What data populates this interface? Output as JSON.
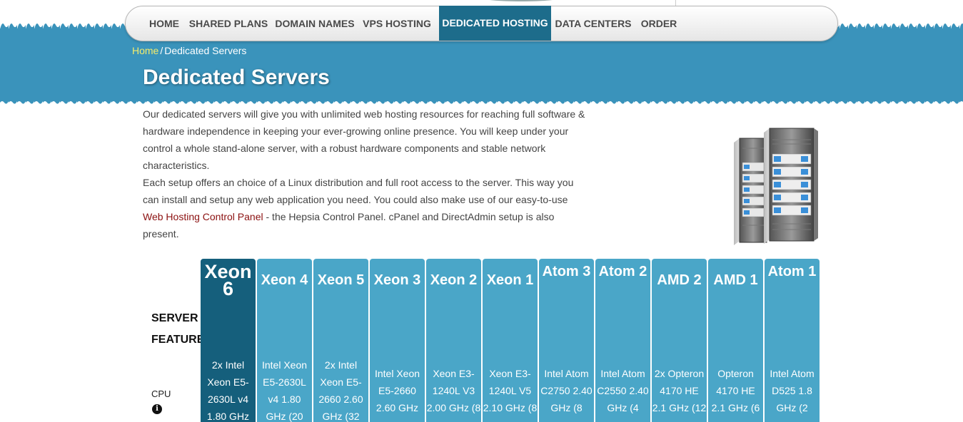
{
  "nav": {
    "items": [
      {
        "label": "HOME"
      },
      {
        "label": "SHARED PLANS"
      },
      {
        "label": "DOMAIN NAMES"
      },
      {
        "label": "VPS HOSTING"
      },
      {
        "label": "DEDICATED HOSTING",
        "active": true
      },
      {
        "label": "DATA CENTERS"
      },
      {
        "label": "ORDER"
      }
    ]
  },
  "breadcrumb": {
    "home": "Home",
    "separator": "/",
    "current": "Dedicated Servers"
  },
  "page": {
    "title": "Dedicated Servers"
  },
  "intro": {
    "p1": "Our dedicated servers will give you with unlimited web hosting resources for reaching full software & hardware independence in keeping your ever-growing online presence. You will keep under your control a whole stand-alone server, with a robust hardware components and stable network characteristics.",
    "p2_start": "Each setup offers an choice of a Linux distribution and full root access to the server. This way you can install and setup any web application you need. You could also make use of our easy-to-use ",
    "p2_link": "Web Hosting Control Panel",
    "p2_end": " - the Hepsia Control Panel. cPanel and DirectAdmin setup is also present."
  },
  "table": {
    "features_label": "SERVER FEATURES",
    "cpu_label": "CPU",
    "info_icon": "i",
    "plans": [
      {
        "name": "Xeon 6",
        "cpu": "2x Intel Xeon E5-2630L v4 1.80 GHz",
        "featured": true
      },
      {
        "name": "Xeon 4",
        "cpu": "Intel Xeon E5-2630L v4 1.80 GHz (20"
      },
      {
        "name": "Xeon 5",
        "cpu": "2x Intel Xeon E5-2660 2.60 GHz (32"
      },
      {
        "name": "Xeon 3",
        "cpu": "Intel Xeon E5-2660 2.60 GHz"
      },
      {
        "name": "Xeon 2",
        "cpu": "Xeon E3-1240L V3 2.00 GHz (8"
      },
      {
        "name": "Xeon 1",
        "cpu": "Xeon E3-1240L V5 2.10 GHz (8"
      },
      {
        "name": "Atom 3",
        "cpu": "Intel Atom C2750 2.40 GHz (8"
      },
      {
        "name": "Atom 2",
        "cpu": "Intel Atom C2550 2.40 GHz (4"
      },
      {
        "name": "AMD 2",
        "cpu": "2x Opteron 4170 HE 2.1 GHz (12"
      },
      {
        "name": "AMD 1",
        "cpu": "Opteron 4170 HE 2.1 GHz (6"
      },
      {
        "name": "Atom 1",
        "cpu": "Intel Atom D525 1.8 GHz (2"
      }
    ]
  },
  "colors": {
    "band": "#3a93bb",
    "nav_active": "#1d6c8b",
    "plan": "#4aa6c8",
    "plan_featured": "#155f7c",
    "link": "#8b1010",
    "breadcrumb_home": "#f5ec6b"
  },
  "icons": {
    "server": "server-rack-icon",
    "info": "info-icon"
  }
}
